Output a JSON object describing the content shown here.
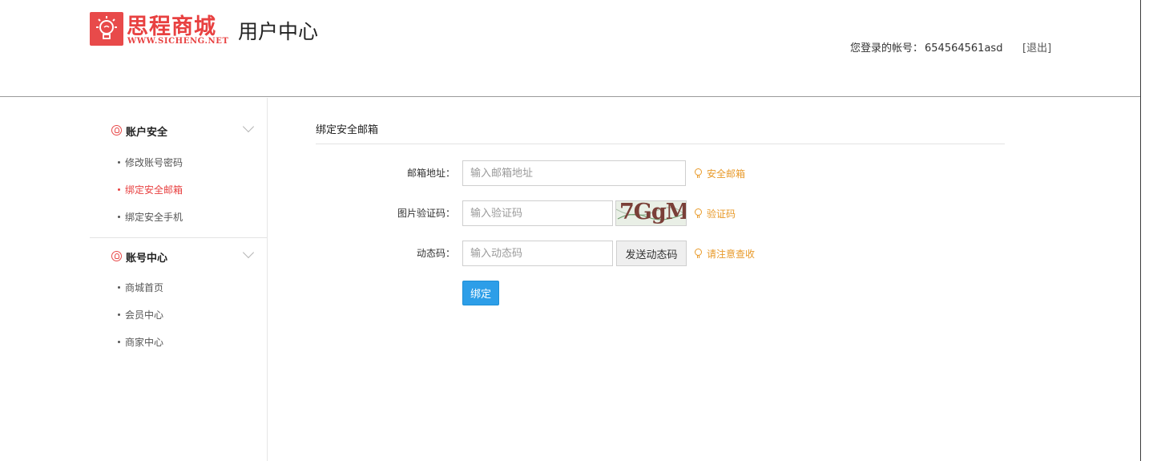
{
  "header": {
    "logo_text": "思程商城",
    "logo_url_text": "WWW.SICHENG.NET",
    "page_title": "用户中心",
    "account_label": "您登录的帐号：",
    "account_id": "654564561asd",
    "logout_label": "[退出]"
  },
  "sidebar": {
    "groups": [
      {
        "icon": "user-circle-icon",
        "title": "账户安全",
        "items": [
          {
            "label": "修改账号密码",
            "active": false
          },
          {
            "label": "绑定安全邮箱",
            "active": true
          },
          {
            "label": "绑定安全手机",
            "active": false
          }
        ]
      },
      {
        "icon": "user-circle-icon",
        "title": "账号中心",
        "items": [
          {
            "label": "商城首页",
            "active": false
          },
          {
            "label": "会员中心",
            "active": false
          },
          {
            "label": "商家中心",
            "active": false
          }
        ]
      }
    ]
  },
  "main": {
    "section_title": "绑定安全邮箱",
    "form": {
      "email": {
        "label": "邮箱地址：",
        "placeholder": "输入邮箱地址",
        "value": "",
        "hint": "安全邮箱"
      },
      "captcha": {
        "label": "图片验证码：",
        "placeholder": "输入验证码",
        "value": "",
        "image_text": "7GgM",
        "hint": "验证码"
      },
      "code": {
        "label": "动态码：",
        "placeholder": "输入动态码",
        "value": "",
        "send_label": "发送动态码",
        "hint": "请注意查收"
      },
      "submit_label": "绑定"
    }
  },
  "colors": {
    "brand_red": "#e84141",
    "hint_orange": "#e89a2a",
    "primary_blue": "#2d9ee8"
  }
}
